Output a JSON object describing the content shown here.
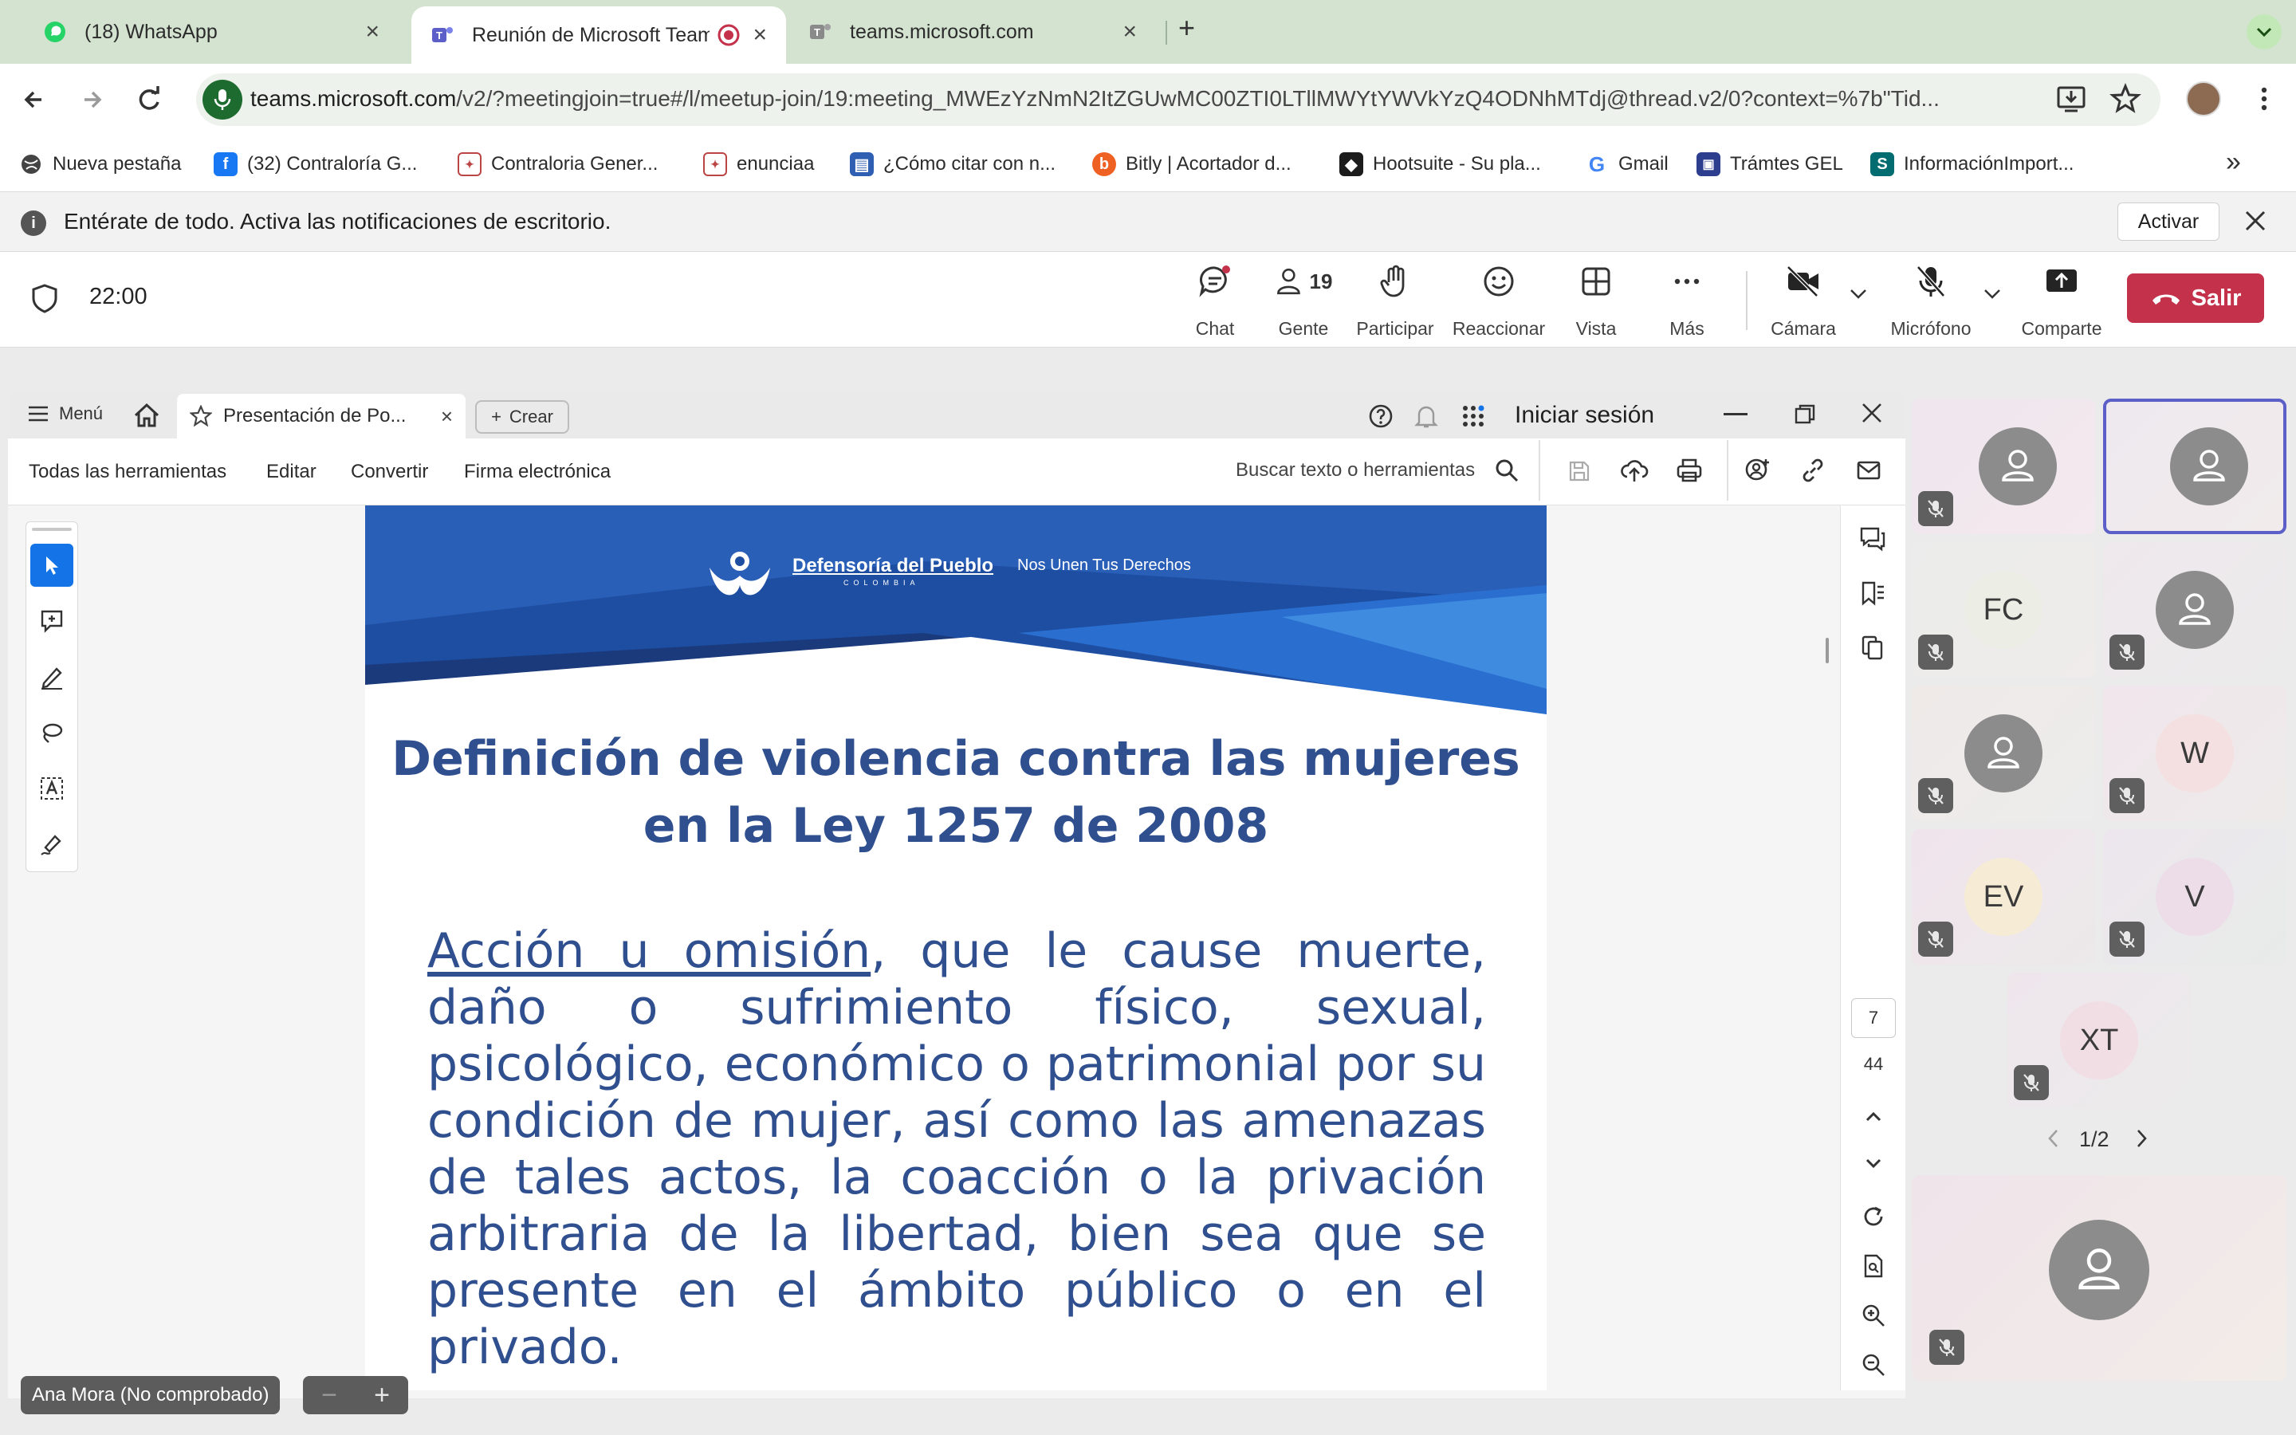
{
  "browser": {
    "tabs": [
      {
        "title": "(18) WhatsApp",
        "icon": "whatsapp-icon"
      },
      {
        "title": "Reunión de Microsoft Teams",
        "icon": "teams-icon",
        "recording": true
      },
      {
        "title": "teams.microsoft.com",
        "icon": "teams-icon"
      }
    ],
    "new_tab": "+",
    "url_host": "teams.microsoft.com",
    "url_path": "/v2/?meetingjoin=true#/l/meetup-join/19:meeting_MWEzYzNmN2ItZGUwMC00ZTI0LTllMWYtYWVkYzQ4ODNhMTdj@thread.v2/0?context=%7b\"Tid...",
    "bookmarks": [
      {
        "label": "Nueva pestaña",
        "icon": "globe-icon"
      },
      {
        "label": "(32) Contraloría G...",
        "icon": "facebook-icon"
      },
      {
        "label": "Contraloria Gener...",
        "icon": "seal-icon"
      },
      {
        "label": "enunciaa",
        "icon": "seal-icon"
      },
      {
        "label": "¿Cómo citar con n...",
        "icon": "doc-icon"
      },
      {
        "label": "Bitly | Acortador d...",
        "icon": "bitly-icon"
      },
      {
        "label": "Hootsuite - Su pla...",
        "icon": "hootsuite-icon"
      },
      {
        "label": "Gmail",
        "icon": "google-icon"
      },
      {
        "label": "Trámtes GEL",
        "icon": "gel-icon"
      },
      {
        "label": "InformaciónImport...",
        "icon": "sharepoint-icon"
      }
    ],
    "more_bookmarks": "»"
  },
  "notification": {
    "text": "Entérate de todo. Activa las notificaciones de escritorio.",
    "action": "Activar"
  },
  "meeting": {
    "timer": "22:00",
    "people_count": "19",
    "buttons": {
      "chat": "Chat",
      "people": "Gente",
      "raise": "Participar",
      "react": "Reaccionar",
      "view": "Vista",
      "more": "Más",
      "camera": "Cámara",
      "mic": "Micrófono",
      "share": "Comparte",
      "leave": "Salir"
    }
  },
  "pdf": {
    "menu": "Menú",
    "doc_tab": "Presentación de Po...",
    "create": "Crear",
    "sign_in": "Iniciar sesión",
    "toolbar": {
      "all_tools": "Todas las herramientas",
      "edit": "Editar",
      "convert": "Convertir",
      "esign": "Firma electrónica",
      "search": "Buscar texto o herramientas"
    },
    "page_current": "7",
    "page_total": "44"
  },
  "slide": {
    "org": "Defensoría del Pueblo",
    "org_sub": "COLOMBIA",
    "slogan": "Nos Unen Tus Derechos",
    "title_line1": "Definición de violencia contra las mujeres",
    "title_line2": "en la Ley 1257 de 2008",
    "body_underlined": "Acción u omisión",
    "body_rest": ", que le cause muerte, daño o sufrimiento físico, sexual, psicológico, económico o patrimonial por su condición de mujer, así como las amenazas de tales actos, la coacción o la privación arbitraria de la libertad, bien sea que se presente en el ámbito público o en el privado."
  },
  "participants": {
    "tiles": [
      {
        "initials": "",
        "muted": true
      },
      {
        "initials": "",
        "muted": false,
        "active": true
      },
      {
        "initials": "FC",
        "muted": true
      },
      {
        "initials": "",
        "muted": true
      },
      {
        "initials": "",
        "muted": true
      },
      {
        "initials": "W",
        "muted": true
      },
      {
        "initials": "EV",
        "muted": true
      },
      {
        "initials": "V",
        "muted": true
      },
      {
        "initials": "XT",
        "muted": true
      }
    ],
    "pager": "1/2"
  },
  "presenter_label": "Ana Mora (No comprobado)",
  "colors": {
    "teams_purple": "#5b5fc7",
    "leave_red": "#c4314b",
    "slide_blue": "#2f4f8f",
    "acrobat_blue": "#1473e6"
  }
}
